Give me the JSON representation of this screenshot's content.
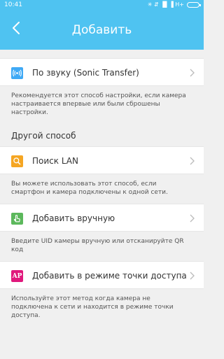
{
  "status": {
    "time": "10:41",
    "indicators": "✳ ⇵ ▐▌▐ H+"
  },
  "header": {
    "title": "Добавить",
    "back_icon": "chevron-left-icon"
  },
  "colors": {
    "header": "#4fc3f1",
    "sonic": "#3fa9f5",
    "lan": "#f5a623",
    "manual": "#5cb85c",
    "ap": "#e0187c"
  },
  "options": [
    {
      "label": "По звуку (Sonic Transfer)",
      "icon": "sound-wave-icon",
      "note": "Рекомендуется этот способ настройки, если камера настраивается впервые или были сброшены настройки."
    },
    {
      "label": "Поиск LAN",
      "icon": "search-icon",
      "note": "Вы можете использовать этот способ, если смартфон и камера подключены к одной сети."
    },
    {
      "label": "Добавить вручную",
      "icon": "hand-pointer-icon",
      "note": "Введите UID камеры вручную или отсканируйте QR код"
    },
    {
      "label": "Добавить в режиме точки доступа",
      "icon_text": "AP",
      "icon": "ap-icon",
      "note": "Используйте этот метод когда камера не подключена к сети и находится в режиме точки доступа."
    }
  ],
  "section": {
    "other_method": "Другой способ"
  }
}
